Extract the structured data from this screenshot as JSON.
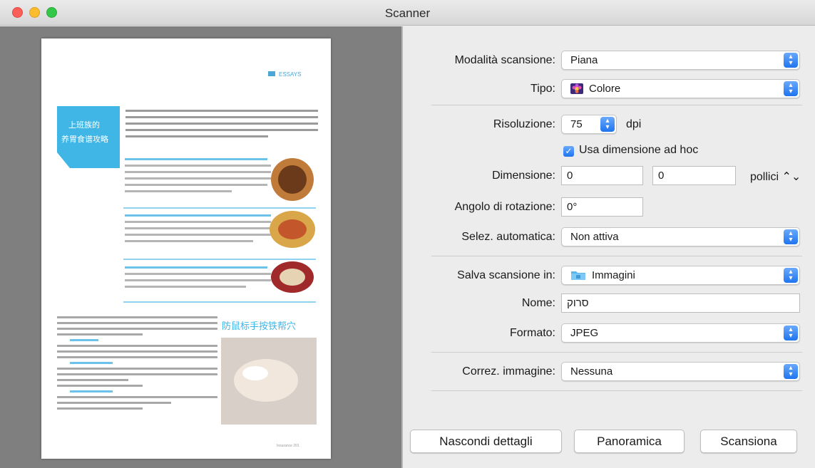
{
  "window": {
    "title": "Scanner"
  },
  "preview": {
    "header_tag": "ESSAYS",
    "banner_text": "上班族的\n养胃食谱攻略",
    "section_heading": "防鼠标手按铁帮穴",
    "page_footer": "Insurance 201"
  },
  "settings": {
    "mode": {
      "label": "Modalità scansione:",
      "value": "Piana"
    },
    "type": {
      "label": "Tipo:",
      "value": "Colore",
      "icon": "color-flower-icon"
    },
    "resolution": {
      "label": "Risoluzione:",
      "value": "75",
      "unit": "dpi"
    },
    "custom_size": {
      "label": "Usa dimensione ad hoc",
      "checked": true
    },
    "size": {
      "label": "Dimensione:",
      "width": "0",
      "height": "0",
      "unit": "pollici ⌃⌄"
    },
    "rotation": {
      "label": "Angolo di rotazione:",
      "value": "0°"
    },
    "auto_select": {
      "label": "Selez. automatica:",
      "value": "Non attiva"
    },
    "save_to": {
      "label": "Salva scansione in:",
      "value": "Immagini",
      "icon": "folder-icon"
    },
    "name": {
      "label": "Nome:",
      "value": "סרוק"
    },
    "format": {
      "label": "Formato:",
      "value": "JPEG"
    },
    "correction": {
      "label": "Correz. immagine:",
      "value": "Nessuna"
    }
  },
  "buttons": {
    "hide_details": "Nascondi dettagli",
    "overview": "Panoramica",
    "scan": "Scansiona"
  },
  "colors": {
    "accent": "#1f74ef",
    "pane_bg": "#7f7f7f",
    "banner": "#3fb6e6"
  }
}
